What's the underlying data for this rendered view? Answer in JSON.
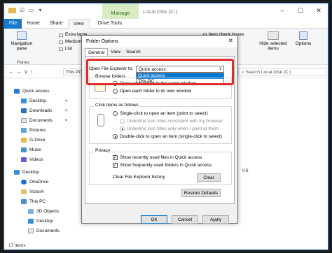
{
  "titlebar": {
    "manage_tab": "Manage",
    "title": "Local Disk (C:)"
  },
  "tabs": [
    "File",
    "Home",
    "Share",
    "View",
    "Drive Tools"
  ],
  "ribbon": {
    "nav_pane": "Navigation pane",
    "panes_group": "Panes",
    "layout": [
      "Extra large",
      "Medium-si",
      "List"
    ],
    "item_check": "Item check boxes",
    "hide_selected": "Hide selected items",
    "options": "Options"
  },
  "address": {
    "path": "This PC",
    "search_placeholder": "Search Local Disk (C:)"
  },
  "nav": {
    "items": [
      "Quick access",
      "Desktop",
      "Downloads",
      "Documents",
      "Pictures",
      "G-Drive",
      "Music",
      "Videos",
      "Desktop",
      "OneDrive",
      "VictorA",
      "This PC",
      "3D Objects",
      "Desktop",
      "Documents"
    ]
  },
  "status": {
    "items": "17 items"
  },
  "files": {
    "size": "KB"
  },
  "dialog": {
    "title": "Folder Options",
    "close": "✕",
    "tabs": [
      "General",
      "View",
      "Search"
    ],
    "open_to_label": "Open File Explorer to:",
    "open_to_value": "Quick access",
    "dropdown_options": [
      "Quick access",
      "This PC"
    ],
    "browse_label": "Browse folders",
    "browse_same": "Open each folder in the same window",
    "browse_own": "Open each folder in its own window",
    "click_label": "Click items as follows",
    "single_click": "Single-click to open an item (point to select)",
    "underline_browser": "Underline icon titles consistent with my browser",
    "underline_point": "Underline icon titles only when I point at them",
    "double_click": "Double-click to open an item (single-click to select)",
    "privacy_label": "Privacy",
    "recent_files": "Show recently used files in Quick access",
    "frequent_folders": "Show frequently used folders in Quick access",
    "clear_history": "Clear File Explorer history",
    "clear_btn": "Clear",
    "restore_btn": "Restore Defaults",
    "ok": "OK",
    "cancel": "Cancel",
    "apply": "Apply"
  },
  "colors": {
    "accent": "#1979ca",
    "highlight": "#e22b2b",
    "selection": "#0078d7"
  }
}
